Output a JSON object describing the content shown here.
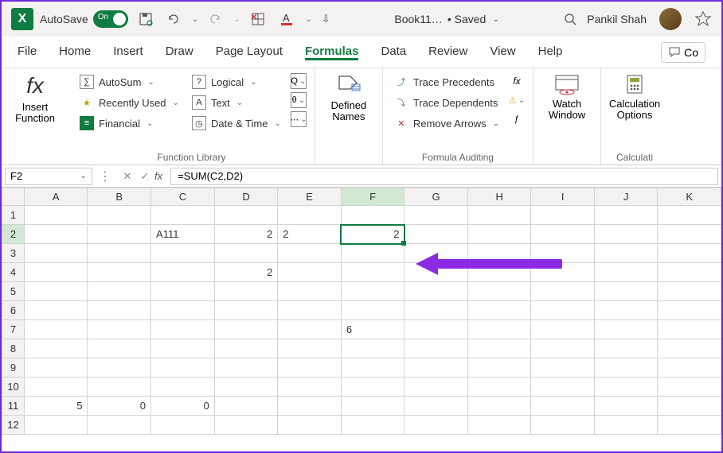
{
  "titlebar": {
    "autosave_label": "AutoSave",
    "autosave_state": "On",
    "doc_name": "Book11…",
    "save_status": "• Saved",
    "username": "Pankil Shah"
  },
  "menu": {
    "items": [
      "File",
      "Home",
      "Insert",
      "Draw",
      "Page Layout",
      "Formulas",
      "Data",
      "Review",
      "View",
      "Help"
    ],
    "active_index": 5,
    "comments_label": "Co"
  },
  "ribbon": {
    "insert_fn": {
      "label": "Insert\nFunction"
    },
    "func_lib": {
      "label": "Function Library",
      "autosum": "AutoSum",
      "recently": "Recently Used",
      "financial": "Financial",
      "logical": "Logical",
      "text": "Text",
      "datetime": "Date & Time"
    },
    "defined_names": {
      "label": "Defined\nNames"
    },
    "auditing": {
      "label": "Formula Auditing",
      "precedents": "Trace Precedents",
      "dependents": "Trace Dependents",
      "remove": "Remove Arrows"
    },
    "watch": {
      "label": "Watch\nWindow"
    },
    "calc": {
      "label": "Calculation\nOptions",
      "group": "Calculati"
    }
  },
  "formula_bar": {
    "cell_ref": "F2",
    "formula": "=SUM(C2,D2)"
  },
  "sheet": {
    "cols": [
      "A",
      "B",
      "C",
      "D",
      "E",
      "F",
      "G",
      "H",
      "I",
      "J",
      "K"
    ],
    "rows": 12,
    "active_cell": "F2",
    "cells": {
      "C2": {
        "v": "A111",
        "a": "txt"
      },
      "D2": {
        "v": "2",
        "a": "num"
      },
      "E2": {
        "v": "2",
        "a": "txt"
      },
      "F2": {
        "v": "2",
        "a": "num"
      },
      "D4": {
        "v": "2",
        "a": "num"
      },
      "F7": {
        "v": "6",
        "a": "txt"
      },
      "A11": {
        "v": "5",
        "a": "num"
      },
      "B11": {
        "v": "0",
        "a": "num"
      },
      "C11": {
        "v": "0",
        "a": "num"
      }
    }
  }
}
